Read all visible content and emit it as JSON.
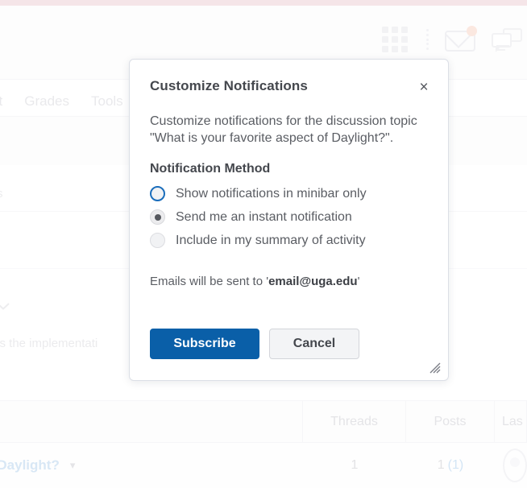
{
  "background": {
    "breadcrumb_fragment": "t",
    "nav_items": [
      "st",
      "Grades",
      "Tools"
    ],
    "content_fragment_1": "s",
    "content_paragraph": "ss the implementati",
    "header_icons": [
      {
        "name": "apps-grid-icon"
      },
      {
        "name": "more-vertical-icon"
      },
      {
        "name": "mail-icon"
      },
      {
        "name": "chat-icon"
      }
    ],
    "table": {
      "columns": [
        "Threads",
        "Posts",
        "Las"
      ],
      "row": {
        "topic": "f Daylight?",
        "threads": "1",
        "posts": "1",
        "posts_unread": "(1)"
      }
    }
  },
  "modal": {
    "title": "Customize Notifications",
    "close_label": "×",
    "description": "Customize notifications for the discussion topic \"What is your favorite aspect of Daylight?\".",
    "method_label": "Notification Method",
    "options": [
      {
        "label": "Show notifications in minibar only",
        "state": "focused"
      },
      {
        "label": "Send me an instant notification",
        "state": "checked"
      },
      {
        "label": "Include in my summary of activity",
        "state": "unchecked"
      }
    ],
    "email_note_prefix": "Emails will be sent to '",
    "email_address": "email@uga.edu",
    "email_note_suffix": "'",
    "primary_button": "Subscribe",
    "secondary_button": "Cancel"
  },
  "colors": {
    "accent_bar": "#e8c6cc",
    "primary_button": "#0a5fa8",
    "focus_ring": "#1a6dbb",
    "link": "#a8cbe8",
    "unread": "#9dc6e8"
  }
}
